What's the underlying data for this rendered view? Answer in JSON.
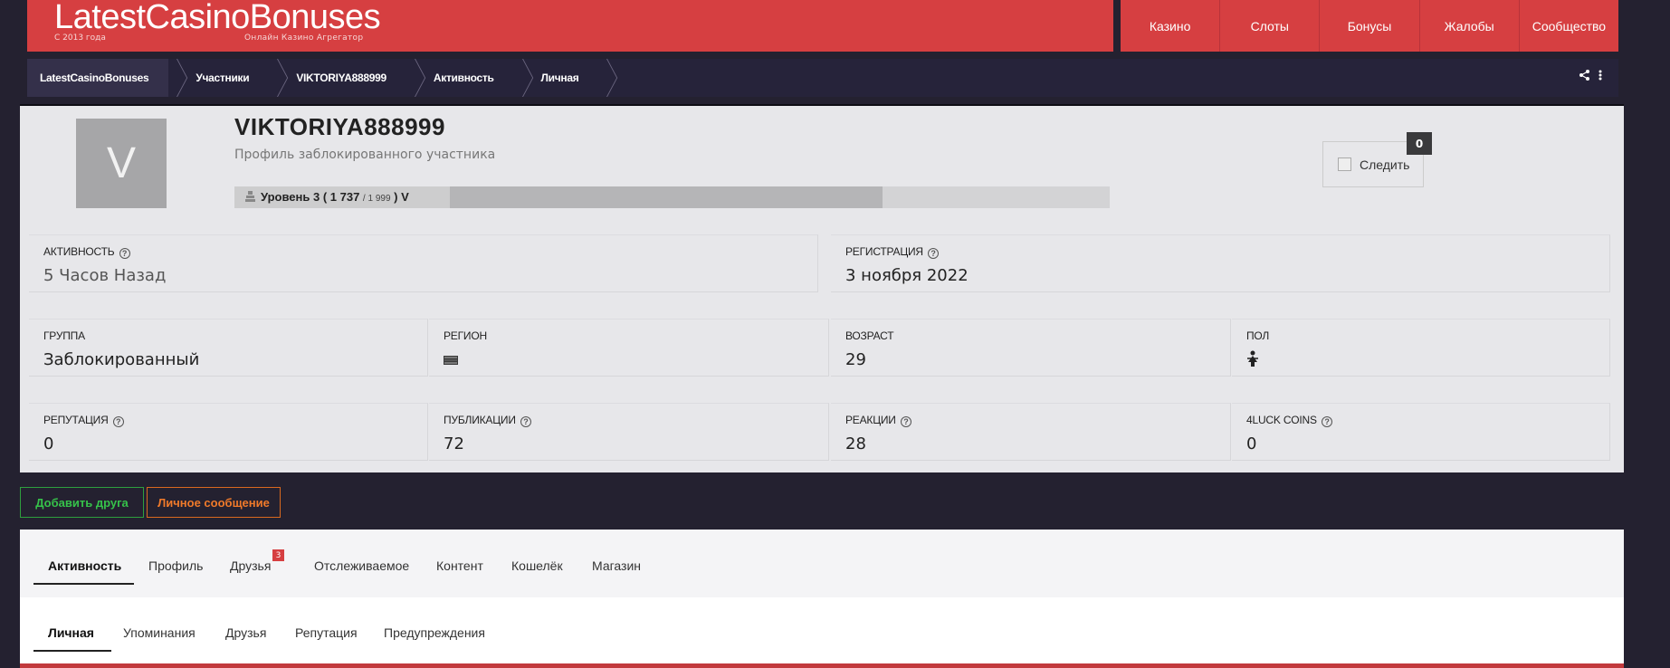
{
  "header": {
    "logo_title": "LatestCasinoBonuses",
    "logo_since": "С 2013 года",
    "logo_subtitle": "Онлайн Казино Агрегатор",
    "nav": [
      "Казино",
      "Слоты",
      "Бонусы",
      "Жалобы",
      "Сообщество"
    ]
  },
  "breadcrumb": [
    "LatestCasinoBonuses",
    "Участники",
    "VIKTORIYA888999",
    "Активность",
    "Личная"
  ],
  "profile": {
    "avatar_letter": "V",
    "username": "VIKTORIYA888999",
    "subtitle": "Профиль заблокированного участника",
    "level": {
      "label": "Уровень 3 ( 1 737",
      "max": "/ 1 999",
      "suffix": ") V",
      "progress": 0.74
    },
    "follow_label": "Следить",
    "follow_count": "0",
    "stats": {
      "activity": {
        "label": "АКТИВНОСТЬ",
        "value": "5 Часов Назад"
      },
      "registration": {
        "label": "РЕГИСТРАЦИЯ",
        "value": "3 ноября 2022"
      },
      "group": {
        "label": "ГРУППА",
        "value": "Заблокированный"
      },
      "region": {
        "label": "РЕГИОН",
        "value": ""
      },
      "age": {
        "label": "ВОЗРАСТ",
        "value": "29"
      },
      "gender": {
        "label": "ПОЛ",
        "value": ""
      },
      "reputation": {
        "label": "РЕПУТАЦИЯ",
        "value": "0"
      },
      "posts": {
        "label": "ПУБЛИКАЦИИ",
        "value": "72"
      },
      "reactions": {
        "label": "РЕАКЦИИ",
        "value": "28"
      },
      "coins": {
        "label": "4LUCK COINS",
        "value": "0"
      }
    }
  },
  "actions": {
    "add_friend": "Добавить друга",
    "message": "Личное сообщение"
  },
  "tabs_main": [
    {
      "label": "Активность"
    },
    {
      "label": "Профиль"
    },
    {
      "label": "Друзья",
      "badge": "3"
    },
    {
      "label": "Отслеживаемое"
    },
    {
      "label": "Контент"
    },
    {
      "label": "Кошелёк"
    },
    {
      "label": "Магазин"
    }
  ],
  "tabs_sub": [
    {
      "label": "Личная"
    },
    {
      "label": "Упоминания"
    },
    {
      "label": "Друзья"
    },
    {
      "label": "Репутация"
    },
    {
      "label": "Предупреждения"
    }
  ],
  "colors": {
    "brand_red": "#d63f41",
    "dark_bg": "#242130",
    "green": "#36c24a",
    "orange": "#f07a2a"
  }
}
